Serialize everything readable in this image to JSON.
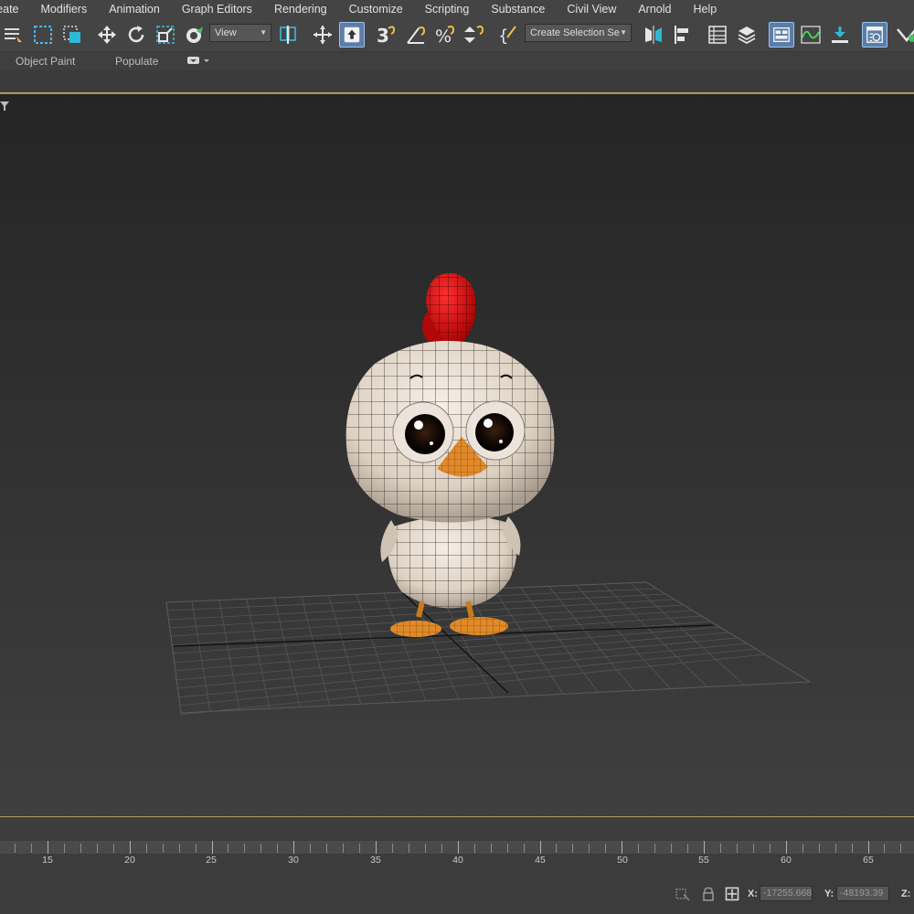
{
  "menu": {
    "items": [
      "reate",
      "Modifiers",
      "Animation",
      "Graph Editors",
      "Rendering",
      "Customize",
      "Scripting",
      "Substance",
      "Civil View",
      "Arnold",
      "Help"
    ]
  },
  "toolbar": {
    "view_dropdown": "View",
    "selection_set_dropdown": "Create Selection Se"
  },
  "ribbon": {
    "object_paint": "Object Paint",
    "populate": "Populate"
  },
  "timeline": {
    "tick_labels": [
      "15",
      "20",
      "25",
      "30",
      "35",
      "40",
      "45",
      "50",
      "55",
      "60",
      "65"
    ]
  },
  "status": {
    "x_label": "X:",
    "x_value": "-17255.668",
    "y_label": "Y:",
    "y_value": "-48193.39",
    "z_label": "Z:"
  },
  "icons": [
    "selection-list-icon",
    "region-select-icon",
    "window-crossing-icon",
    "move-icon",
    "rotate-icon",
    "scale-icon",
    "place-icon",
    "pivot-icon",
    "manipulate-icon",
    "keyboard-shortcut-icon",
    "snap-3d-icon",
    "angle-snap-icon",
    "percent-snap-icon",
    "spinner-snap-icon",
    "named-selection-icon",
    "mirror-icon",
    "align-icon",
    "scene-explorer-icon",
    "layer-explorer-icon",
    "ribbon-toggle-icon",
    "curve-editor-icon",
    "schematic-icon",
    "render-setup-icon",
    "render-frame-icon",
    "viewport-filter-icon",
    "isolate-icon",
    "lock-icon",
    "absolute-mode-icon"
  ],
  "colors": {
    "ui_background": "#444444",
    "active_button": "#5a7ea8",
    "viewport_border": "#a99a5a",
    "comb": "#cc1010",
    "beak": "#e08a2a",
    "body": "#e8ded2"
  }
}
